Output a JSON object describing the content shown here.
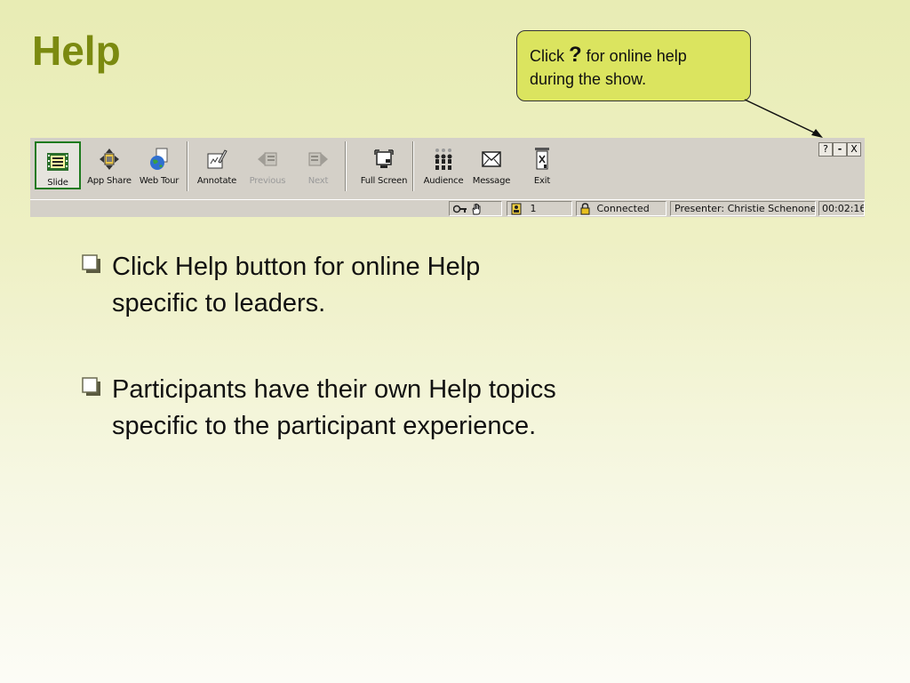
{
  "slide": {
    "title": "Help",
    "callout": {
      "prefix": "Click ",
      "symbol": "?",
      "line1_rest": " for online help",
      "line2": "during the show."
    }
  },
  "toolbar": {
    "buttons": [
      {
        "label": "Slide",
        "icon": "slide-icon",
        "active": true
      },
      {
        "label": "App Share",
        "icon": "app-share-icon"
      },
      {
        "label": "Web Tour",
        "icon": "web-tour-icon"
      },
      {
        "label": "Annotate",
        "icon": "annotate-icon"
      },
      {
        "label": "Previous",
        "icon": "previous-icon",
        "disabled": true
      },
      {
        "label": "Next",
        "icon": "next-icon",
        "disabled": true
      },
      {
        "label": "Full Screen",
        "icon": "full-screen-icon"
      },
      {
        "label": "Audience",
        "icon": "audience-icon"
      },
      {
        "label": "Message",
        "icon": "message-icon"
      },
      {
        "label": "Exit",
        "icon": "exit-icon"
      }
    ],
    "window_controls": {
      "help": "?",
      "minimize": "-",
      "close": "X"
    }
  },
  "statusbar": {
    "participant_count": "1",
    "connection": "Connected",
    "presenter": "Presenter: Christie Schenone",
    "timer": "00:02:16"
  },
  "bullets": [
    {
      "line1": "Click Help button for online Help",
      "line2": "specific to leaders."
    },
    {
      "line1": "Participants have their own Help topics",
      "line2": "specific to the participant experience."
    }
  ],
  "colors": {
    "title": "#7b8a10",
    "callout_fill": "#dbe45f",
    "bullet_box": "#c4c99a"
  }
}
